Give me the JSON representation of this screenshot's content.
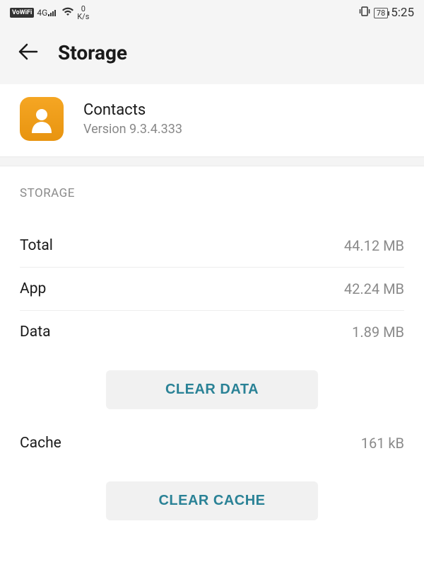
{
  "statusbar": {
    "vowifi": "VoWiFi",
    "network": "4G",
    "speed_value": "0",
    "speed_unit": "K/s",
    "battery": "78",
    "time": "5:25"
  },
  "header": {
    "title": "Storage"
  },
  "app": {
    "name": "Contacts",
    "version_label": "Version 9.3.4.333"
  },
  "section_label": "STORAGE",
  "rows": {
    "total": {
      "label": "Total",
      "value": "44.12 MB"
    },
    "app": {
      "label": "App",
      "value": "42.24 MB"
    },
    "data": {
      "label": "Data",
      "value": "1.89 MB"
    },
    "cache": {
      "label": "Cache",
      "value": "161 kB"
    }
  },
  "buttons": {
    "clear_data": "CLEAR DATA",
    "clear_cache": "CLEAR CACHE"
  }
}
